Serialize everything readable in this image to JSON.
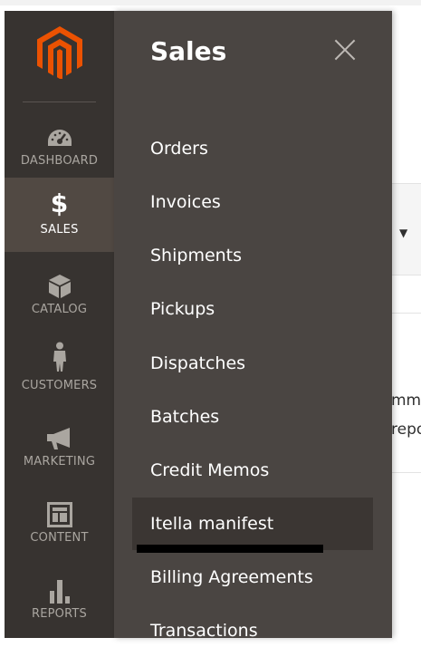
{
  "nav": {
    "items": [
      {
        "label": "DASHBOARD",
        "icon": "dashboard-icon"
      },
      {
        "label": "SALES",
        "icon": "dollar-icon"
      },
      {
        "label": "CATALOG",
        "icon": "box-icon"
      },
      {
        "label": "CUSTOMERS",
        "icon": "person-icon"
      },
      {
        "label": "MARKETING",
        "icon": "megaphone-icon"
      },
      {
        "label": "CONTENT",
        "icon": "layout-icon"
      },
      {
        "label": "REPORTS",
        "icon": "bar-chart-icon"
      }
    ],
    "active": "SALES"
  },
  "flyout": {
    "title": "Sales",
    "items": [
      "Orders",
      "Invoices",
      "Shipments",
      "Pickups",
      "Dispatches",
      "Batches",
      "Credit Memos",
      "Itella manifest",
      "Billing Agreements",
      "Transactions"
    ],
    "highlighted": "Itella manifest"
  },
  "background": {
    "text1": "mma",
    "text2": "repo"
  },
  "colors": {
    "nav_bg": "#373330",
    "nav_active": "#514943",
    "flyout_bg": "#4a4542",
    "logo": "#eb5202"
  }
}
